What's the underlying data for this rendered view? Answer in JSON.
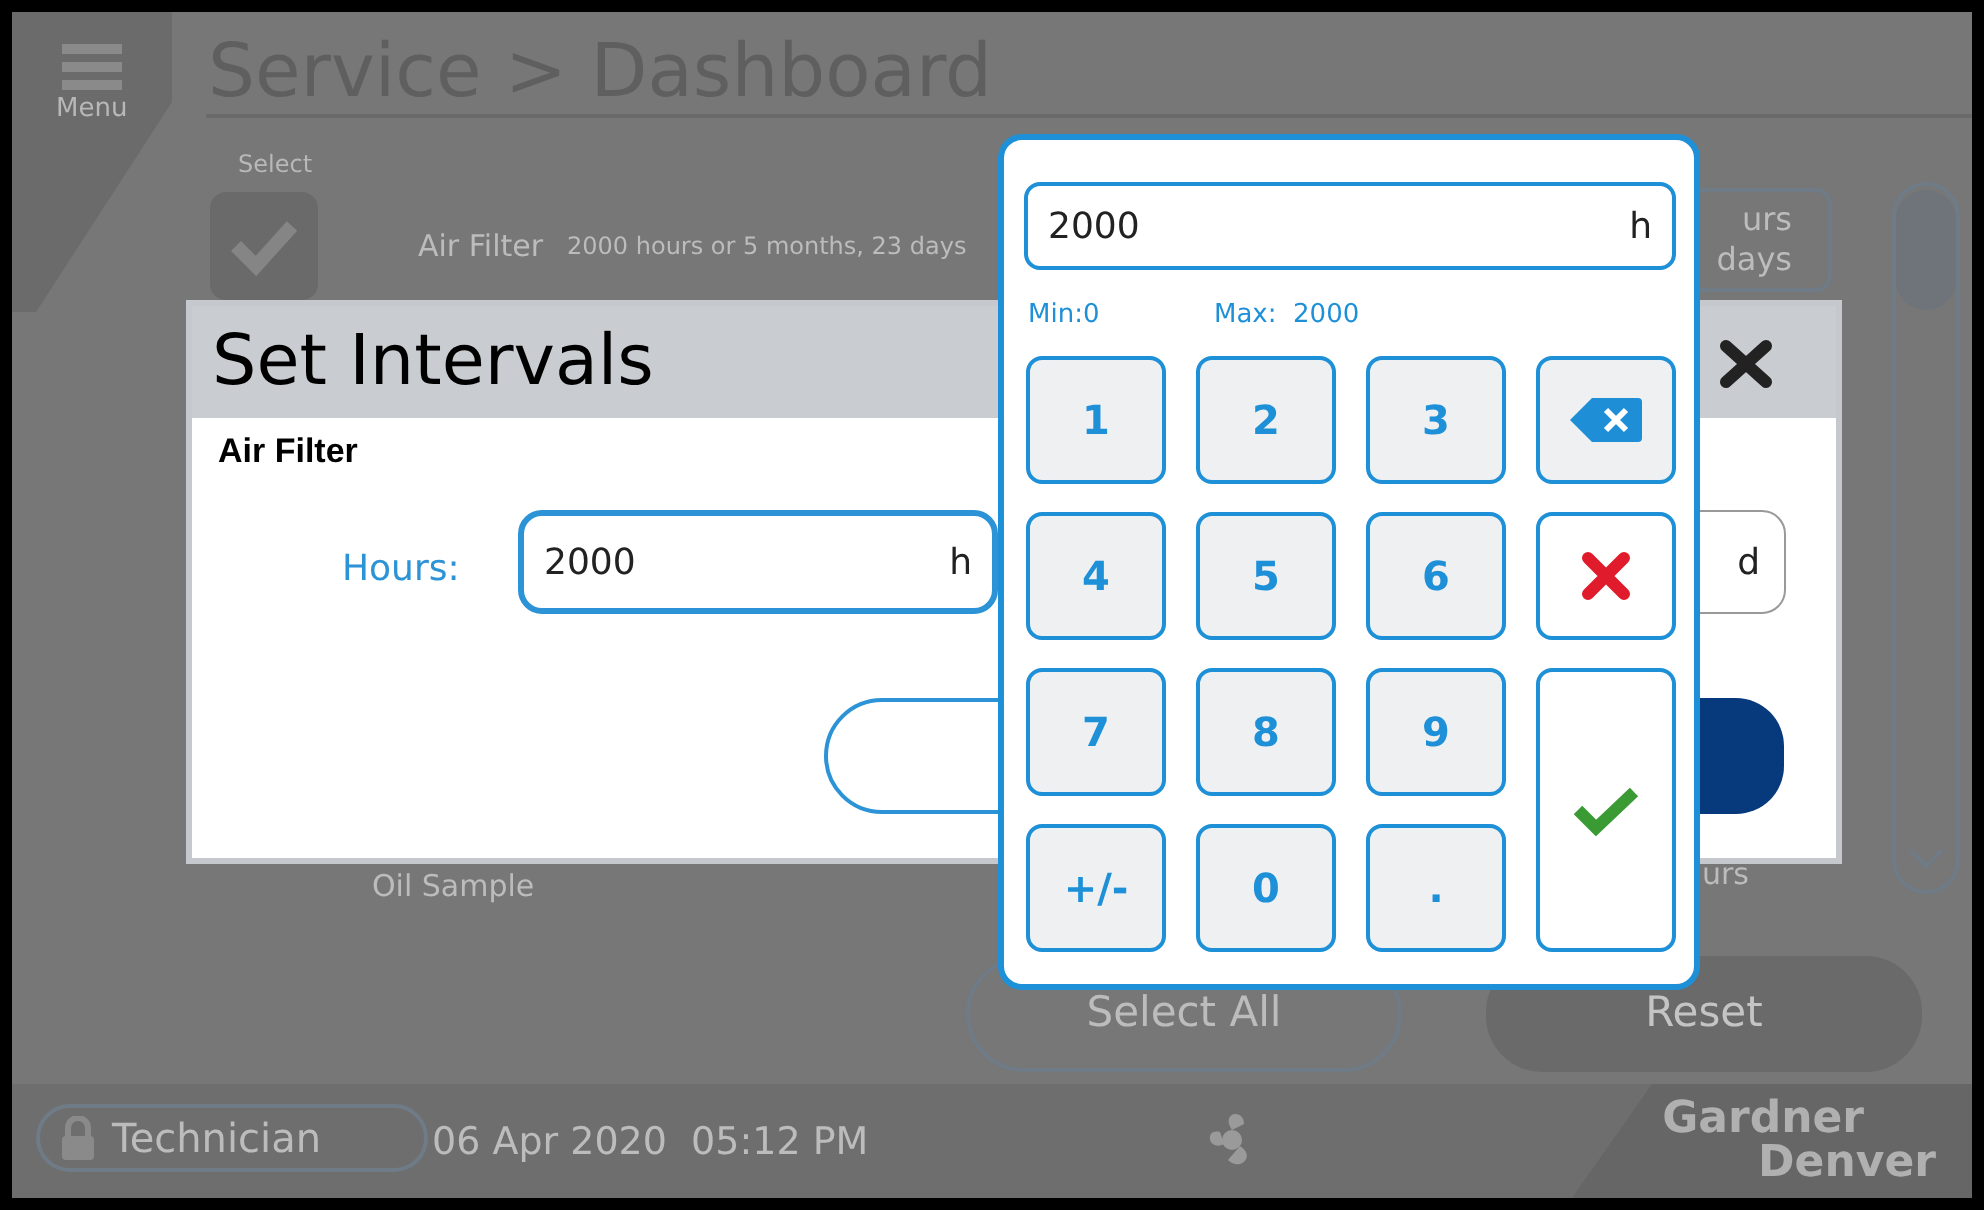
{
  "screen": {
    "menu_label": "Menu",
    "title": "Service > Dashboard",
    "select_header": "Select",
    "rows": [
      {
        "name": "Air Filter",
        "interval": "2000 hours or 5 months, 23 days",
        "checked": true,
        "edit_line1": "urs",
        "edit_line2": "days"
      },
      {
        "name": "Oil Sample",
        "edit_line1": "urs"
      }
    ],
    "buttons": [
      {
        "label": "Select All",
        "kind": "outline"
      },
      {
        "label": "Reset",
        "kind": "filled"
      }
    ],
    "status_bar": {
      "user": "Technician",
      "datetime": "06 Apr 2020  05:12 PM",
      "brand_line1": "Gardner",
      "brand_line2": "Denver"
    }
  },
  "dialog": {
    "title": "Set Intervals",
    "item": "Air Filter",
    "hours_label": "Hours:",
    "hours_value": "2000",
    "hours_unit": "h",
    "days_unit": "d"
  },
  "keypad": {
    "value": "2000",
    "unit": "h",
    "min": "Min:0",
    "max": "Max:  2000",
    "keys": [
      {
        "kind": "digit",
        "label": "1"
      },
      {
        "kind": "digit",
        "label": "2"
      },
      {
        "kind": "digit",
        "label": "3"
      },
      {
        "kind": "backspace"
      },
      {
        "kind": "digit",
        "label": "4"
      },
      {
        "kind": "digit",
        "label": "5"
      },
      {
        "kind": "digit",
        "label": "6"
      },
      {
        "kind": "clear"
      },
      {
        "kind": "digit",
        "label": "7"
      },
      {
        "kind": "digit",
        "label": "8"
      },
      {
        "kind": "digit",
        "label": "9"
      },
      {
        "kind": "enter"
      },
      {
        "kind": "digit",
        "label": "+/-"
      },
      {
        "kind": "digit",
        "label": "0"
      },
      {
        "kind": "digit",
        "label": "."
      }
    ]
  }
}
